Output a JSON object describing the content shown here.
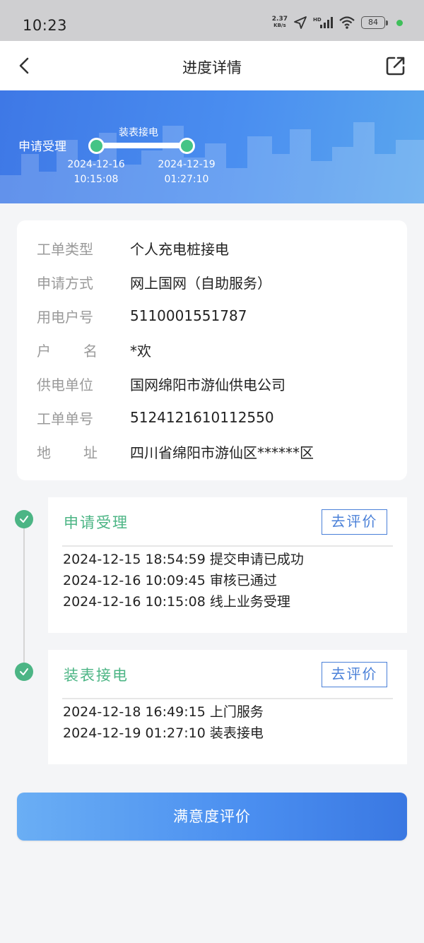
{
  "status_bar": {
    "time": "10:23",
    "net_speed_value": "2.37",
    "net_speed_unit": "KB/s",
    "battery": "84"
  },
  "nav": {
    "title": "进度详情",
    "back_icon": "chevron-left-icon",
    "share_icon": "share-external-icon"
  },
  "progress": {
    "start_label": "申请受理",
    "mid_label": "装表接电",
    "node1_date": "2024-12-16",
    "node1_time": "10:15:08",
    "node2_date": "2024-12-19",
    "node2_time": "01:27:10",
    "node_color": "#45c486"
  },
  "info": {
    "rows": [
      {
        "label": "工单类型",
        "value": "个人充电桩接电"
      },
      {
        "label": "申请方式",
        "value": "网上国网（自助服务）"
      },
      {
        "label": "用电户号",
        "value": "5110001551787"
      },
      {
        "label": [
          "户",
          "名"
        ],
        "value": "*欢"
      },
      {
        "label": "供电单位",
        "value": "国网绵阳市游仙供电公司"
      },
      {
        "label": "工单单号",
        "value": "5124121610112550"
      },
      {
        "label": [
          "地",
          "址"
        ],
        "value": "四川省绵阳市游仙区******区"
      }
    ]
  },
  "timeline": [
    {
      "title": "申请受理",
      "rate_label": "去评价",
      "records": [
        "2024-12-15 18:54:59 提交申请已成功",
        "2024-12-16 10:09:45 审核已通过",
        "2024-12-16 10:15:08 线上业务受理"
      ]
    },
    {
      "title": "装表接电",
      "rate_label": "去评价",
      "records": [
        "2024-12-18 16:49:15 上门服务",
        "2024-12-19 01:27:10 装表接电"
      ]
    }
  ],
  "main_button": "满意度评价",
  "colors": {
    "accent_blue": "#4a8ef0",
    "success_green": "#4cb585"
  }
}
